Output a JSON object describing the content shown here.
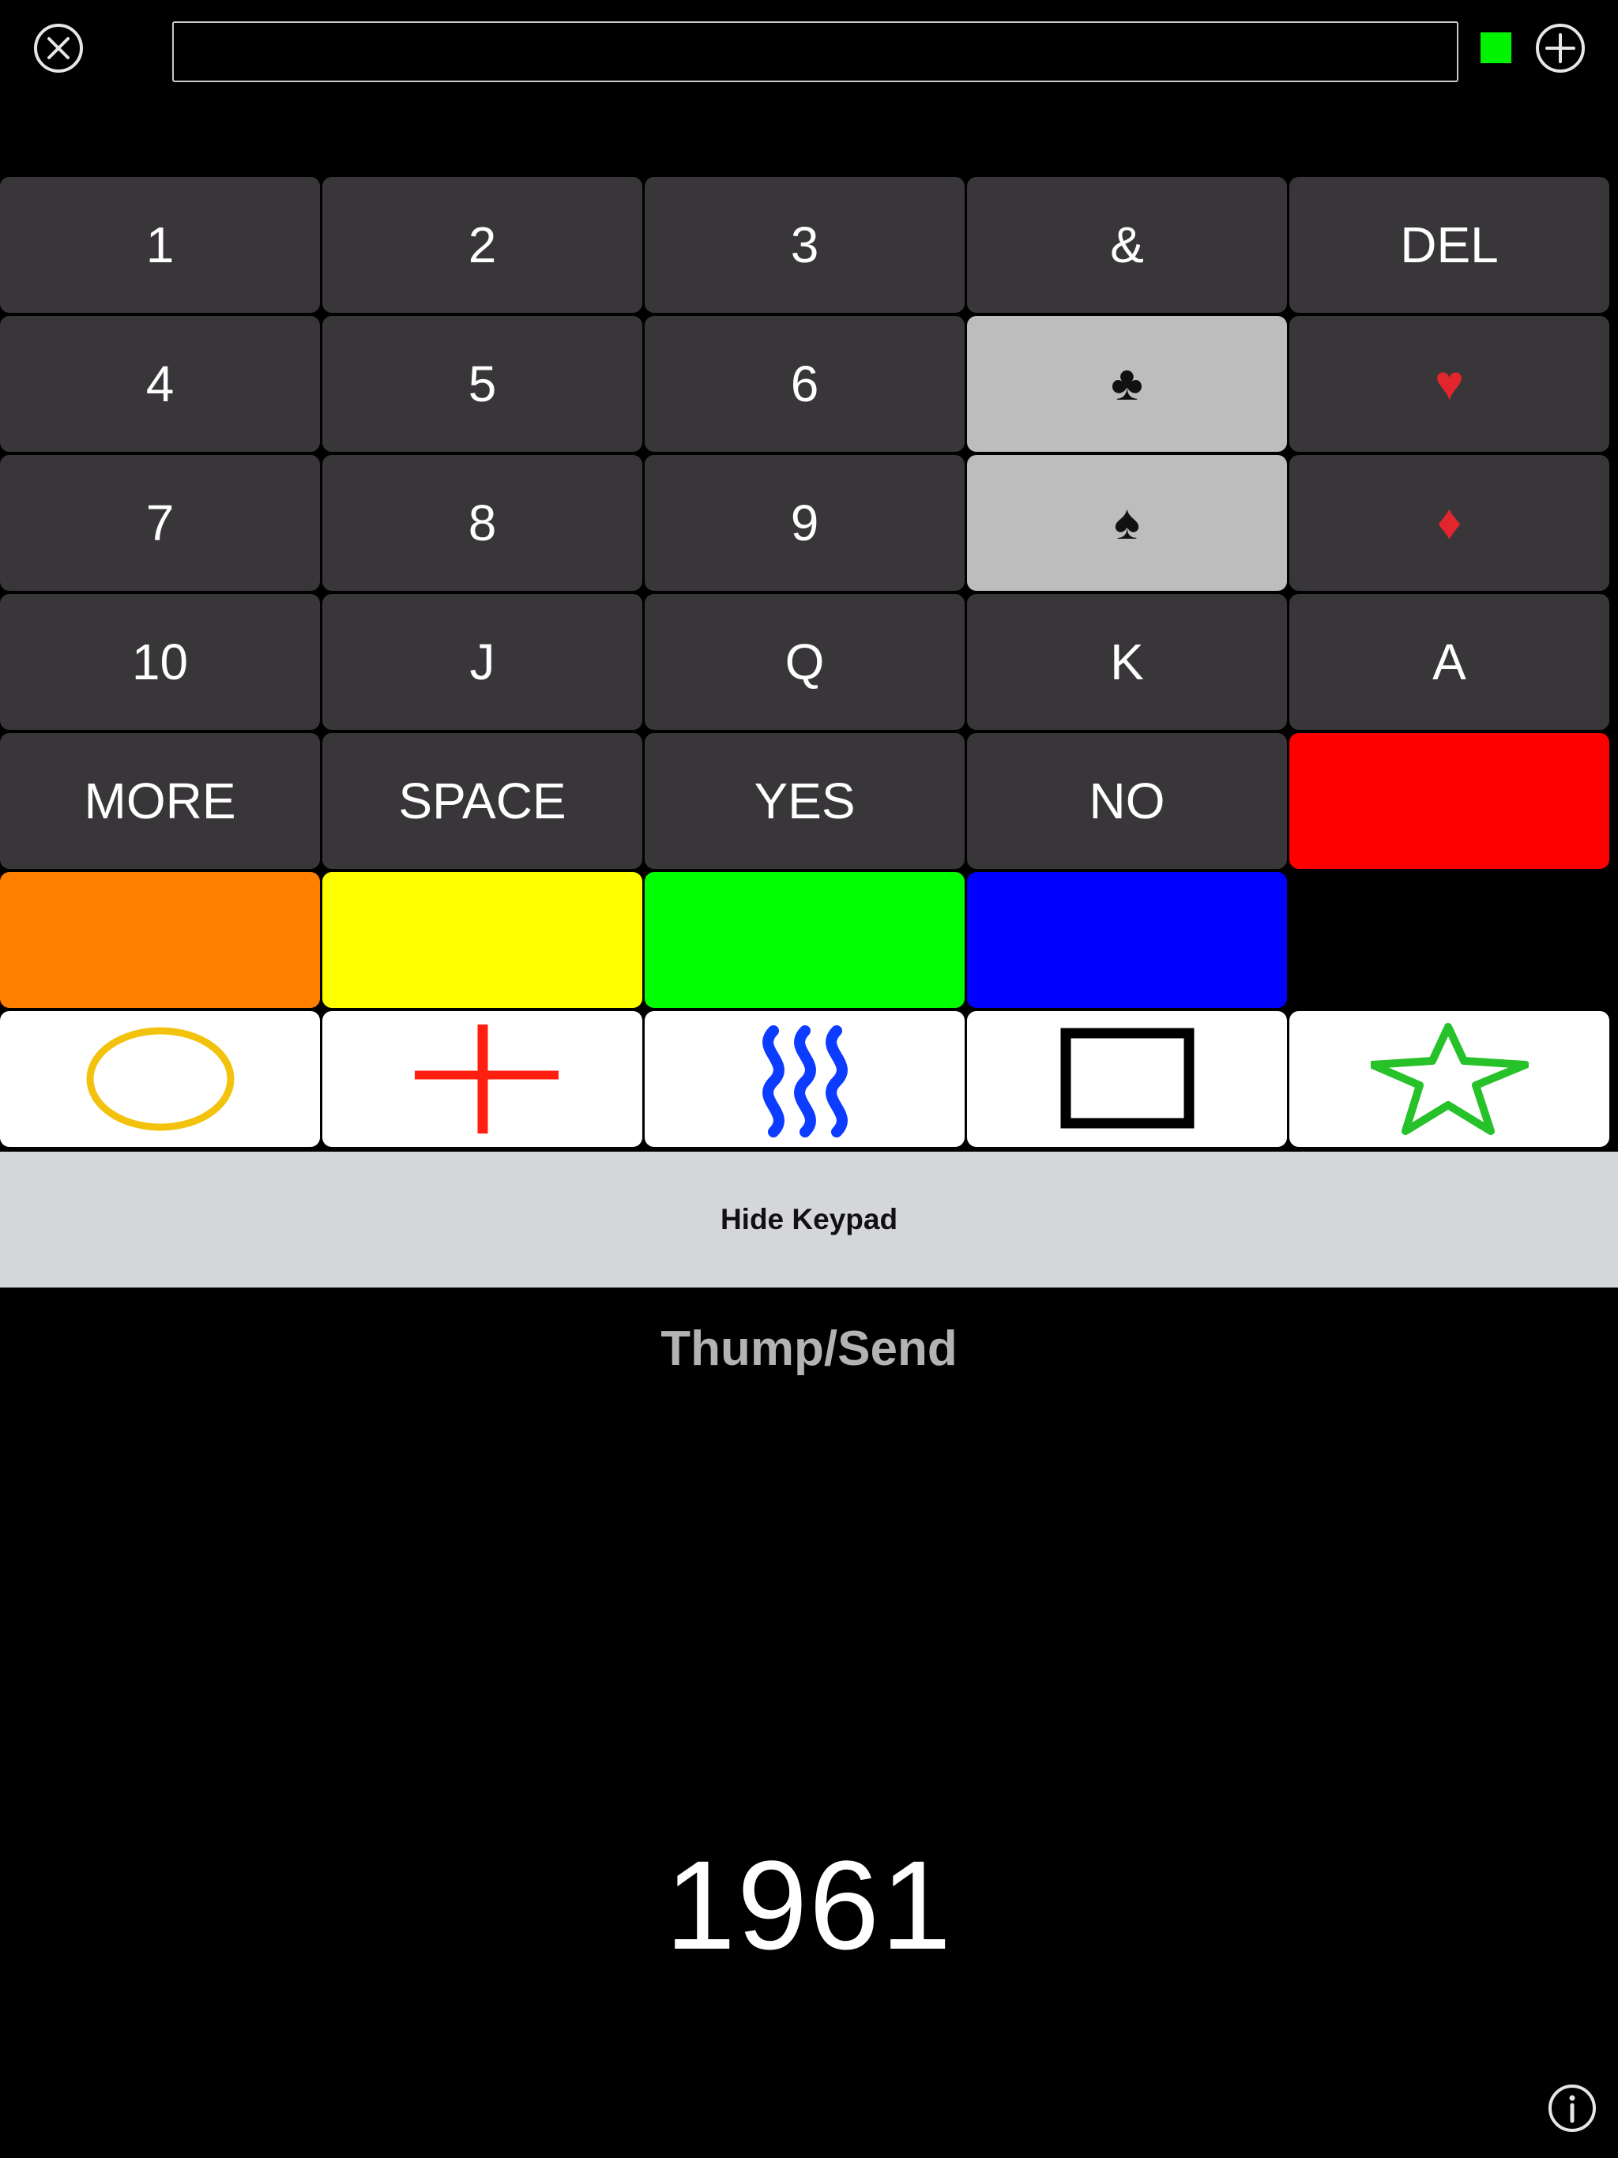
{
  "header": {
    "close_icon": "close-circle-icon",
    "add_icon": "add-circle-icon",
    "input_value": "",
    "input_placeholder": "",
    "status_color": "#00f400"
  },
  "keypad": {
    "row1": [
      "1",
      "2",
      "3",
      "&",
      "DEL"
    ],
    "row2": [
      "4",
      "5",
      "6",
      "♣",
      "♥"
    ],
    "row3": [
      "7",
      "8",
      "9",
      "♠",
      "♦"
    ],
    "row4": [
      "10",
      "J",
      "Q",
      "K",
      "A"
    ],
    "row5": [
      "MORE",
      "SPACE",
      "YES",
      "NO",
      ""
    ],
    "colors": {
      "red": "#ff0000",
      "orange": "#ff8000",
      "yellow": "#ffff00",
      "green": "#00ff00",
      "blue": "#0000ff"
    },
    "symbols": [
      "circle",
      "cross",
      "waves",
      "square",
      "star"
    ],
    "symbol_colors": {
      "circle": "#f2c20c",
      "cross": "#ff1f10",
      "waves": "#0b3cff",
      "square": "#000000",
      "star": "#27c22a"
    },
    "hide_label": "Hide Keypad"
  },
  "send_label": "Thump/Send",
  "display_number": "1961",
  "footer": {
    "info_icon": "info-circle-icon"
  }
}
